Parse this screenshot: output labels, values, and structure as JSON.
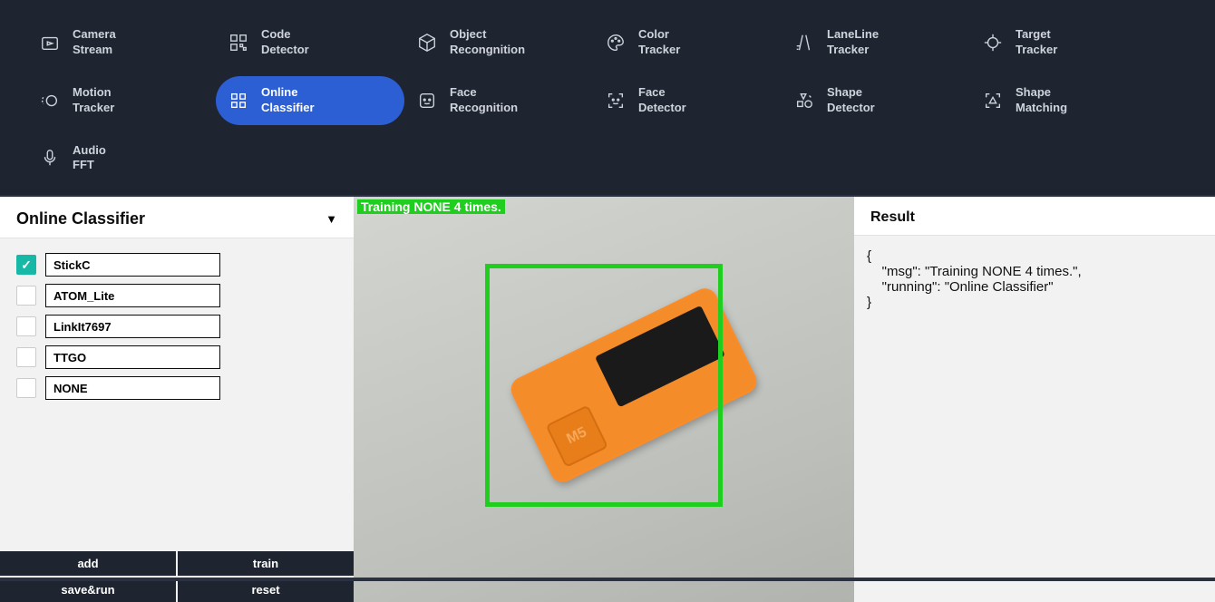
{
  "nav": {
    "rows": [
      [
        {
          "label1": "Camera",
          "label2": "Stream",
          "icon": "camera"
        },
        {
          "label1": "Code",
          "label2": "Detector",
          "icon": "qr"
        },
        {
          "label1": "Object",
          "label2": "Recongnition",
          "icon": "cube"
        },
        {
          "label1": "Color",
          "label2": "Tracker",
          "icon": "palette"
        },
        {
          "label1": "LaneLine",
          "label2": "Tracker",
          "icon": "lane"
        },
        {
          "label1": "Target",
          "label2": "Tracker",
          "icon": "target"
        }
      ],
      [
        {
          "label1": "Motion",
          "label2": "Tracker",
          "icon": "motion"
        },
        {
          "label1": "Online",
          "label2": "Classifier",
          "icon": "grid",
          "active": true
        },
        {
          "label1": "Face",
          "label2": "Recognition",
          "icon": "face"
        },
        {
          "label1": "Face",
          "label2": "Detector",
          "icon": "facedet"
        },
        {
          "label1": "Shape",
          "label2": "Detector",
          "icon": "shape"
        },
        {
          "label1": "Shape",
          "label2": "Matching",
          "icon": "shapematch"
        }
      ],
      [
        {
          "label1": "Audio",
          "label2": "FFT",
          "icon": "mic"
        }
      ]
    ]
  },
  "sidebar": {
    "title": "Online Classifier",
    "classes": [
      {
        "name": "StickC",
        "checked": true
      },
      {
        "name": "ATOM_Lite",
        "checked": false
      },
      {
        "name": "LinkIt7697",
        "checked": false
      },
      {
        "name": "TTGO",
        "checked": false
      },
      {
        "name": "NONE",
        "checked": false
      }
    ],
    "buttons": {
      "add": "add",
      "train": "train",
      "saverun": "save&run",
      "reset": "reset"
    }
  },
  "camera": {
    "overlay_text": "Training NONE 4 times.",
    "device_text": "M5"
  },
  "result": {
    "title": "Result",
    "json_text": "{\n    \"msg\": \"Training NONE 4 times.\",\n    \"running\": \"Online Classifier\"\n}"
  }
}
